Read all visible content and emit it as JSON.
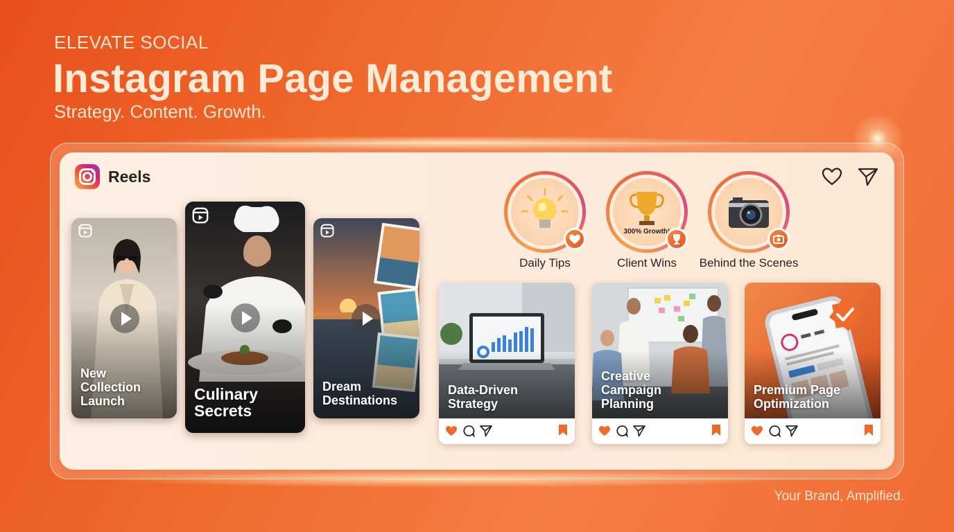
{
  "header": {
    "brand": "ELEVATE SOCIAL",
    "title": "Instagram Page Management",
    "subtitle": "Strategy. Content. Growth."
  },
  "footer": {
    "tagline": "Your Brand, Amplified."
  },
  "panel": {
    "section_title": "Reels",
    "logo_icon": "instagram-logo",
    "top_icons": [
      "heart-icon",
      "send-icon"
    ]
  },
  "reels": [
    {
      "caption_lines": [
        "New",
        "Collection",
        "Launch"
      ],
      "icon": "reels-icon"
    },
    {
      "caption_lines": [
        "Culinary",
        "Secrets"
      ],
      "icon": "reels-icon"
    },
    {
      "caption_lines": [
        "Dream",
        "Destinations"
      ],
      "icon": "reels-icon"
    }
  ],
  "highlights": [
    {
      "label": "Daily Tips",
      "icon": "lightbulb-icon",
      "badge_icon": "heart-icon"
    },
    {
      "label": "Client Wins",
      "icon": "trophy-icon",
      "badge_icon": "trophy-icon",
      "inner_text": "300% Growth!"
    },
    {
      "label": "Behind the Scenes",
      "icon": "camera-icon",
      "badge_icon": "camera-icon"
    }
  ],
  "posts": [
    {
      "caption_lines": [
        "Data-Driven",
        "Strategy"
      ]
    },
    {
      "caption_lines": [
        "Creative",
        "Campaign",
        "Planning"
      ]
    },
    {
      "caption_lines": [
        "Premium Page",
        "Optimization"
      ]
    }
  ],
  "post_actions": [
    "heart-icon",
    "comment-icon",
    "share-icon",
    "bookmark-icon"
  ],
  "colors": {
    "accent": "#f06a2c",
    "panel": "#fcefe2",
    "text_dark": "#2a2320"
  }
}
